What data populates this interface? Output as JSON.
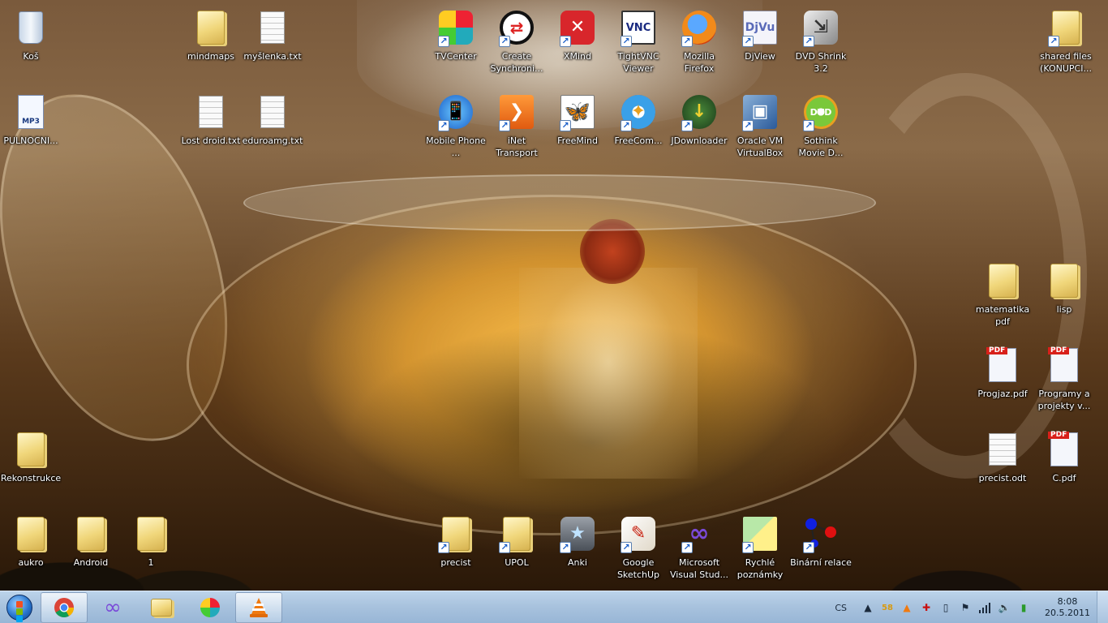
{
  "desktop_icons": {
    "recycle_bin": {
      "label": "Koš",
      "icon": "recycle-bin-icon"
    },
    "mindmaps": {
      "label": "mindmaps",
      "icon": "folder-icon"
    },
    "myslenka": {
      "label": "myšlenka.txt",
      "icon": "text-file-icon"
    },
    "tvcenter": {
      "label": "TVCenter",
      "icon": "tvcenter-icon"
    },
    "create_sync": {
      "label": "Create Synchroni...",
      "icon": "sync-icon"
    },
    "xmind": {
      "label": "XMind",
      "icon": "xmind-icon"
    },
    "tightvnc": {
      "label": "TightVNC Viewer",
      "icon": "vnc-icon"
    },
    "firefox": {
      "label": "Mozilla Firefox",
      "icon": "firefox-icon"
    },
    "djview": {
      "label": "DjView",
      "icon": "djview-icon"
    },
    "dvdshrink": {
      "label": "DVD Shrink 3.2",
      "icon": "dvd-shrink-icon"
    },
    "shared_files": {
      "label": "shared files (KONUPCI...",
      "icon": "folder-icon"
    },
    "pulnocni": {
      "label": "PULNOCNI...",
      "icon": "mp3-file-icon",
      "badge": "MP3"
    },
    "lost_droid": {
      "label": "Lost droid.txt",
      "icon": "text-file-icon"
    },
    "eduroamg": {
      "label": "eduroamg.txt",
      "icon": "text-file-icon"
    },
    "mobile_phone": {
      "label": "Mobile Phone ...",
      "icon": "mobile-phone-icon"
    },
    "inet_transport": {
      "label": "iNet Transport",
      "icon": "transport-icon"
    },
    "freemind": {
      "label": "FreeMind",
      "icon": "butterfly-icon"
    },
    "freecom": {
      "label": "FreeCom...",
      "icon": "compass-icon"
    },
    "jdownloader": {
      "label": "JDownloader",
      "icon": "jdownloader-icon"
    },
    "virtualbox": {
      "label": "Oracle VM VirtualBox",
      "icon": "virtualbox-icon"
    },
    "sothink": {
      "label": "Sothink Movie D...",
      "icon": "dvd-icon"
    },
    "matematika": {
      "label": "matematika pdf",
      "icon": "folder-icon"
    },
    "lisp": {
      "label": "lisp",
      "icon": "folder-icon"
    },
    "progjaz": {
      "label": "Progjaz.pdf",
      "icon": "pdf-file-icon"
    },
    "programy": {
      "label": "Programy a projekty v...",
      "icon": "pdf-file-icon"
    },
    "rekonstrukce": {
      "label": "Rekonstrukce",
      "icon": "folder-icon"
    },
    "precist_odt": {
      "label": "precist.odt",
      "icon": "document-icon"
    },
    "c_pdf": {
      "label": "C.pdf",
      "icon": "pdf-file-icon"
    },
    "aukro": {
      "label": "aukro",
      "icon": "folder-icon"
    },
    "android": {
      "label": "Android",
      "icon": "folder-icon"
    },
    "one": {
      "label": "1",
      "icon": "folder-icon"
    },
    "precist": {
      "label": "precist",
      "icon": "folder-icon"
    },
    "upol": {
      "label": "UPOL",
      "icon": "folder-icon"
    },
    "anki": {
      "label": "Anki",
      "icon": "anki-icon"
    },
    "sketchup": {
      "label": "Google SketchUp",
      "icon": "sketchup-icon"
    },
    "visual_studio": {
      "label": "Microsoft Visual Stud...",
      "icon": "visual-studio-icon"
    },
    "rychle_poznamky": {
      "label": "Rychlé poznámky",
      "icon": "sticky-notes-icon"
    },
    "binarni_relace": {
      "label": "Binární relace",
      "icon": "graph-icon"
    }
  },
  "taskbar": {
    "start_icon": "windows-start-icon",
    "pinned": [
      {
        "name": "chrome",
        "icon": "chrome-icon",
        "active": true
      },
      {
        "name": "visual-studio",
        "icon": "visual-studio-icon",
        "active": false
      },
      {
        "name": "explorer",
        "icon": "folder-icon",
        "active": false
      },
      {
        "name": "tvcenter",
        "icon": "tvcenter-icon",
        "active": false
      },
      {
        "name": "vlc",
        "icon": "vlc-icon",
        "active": true
      }
    ],
    "tray": {
      "language": "CS",
      "badge_number": "58",
      "clock_time": "8:08",
      "clock_date": "20.5.2011"
    }
  },
  "colors": {
    "taskbar": "#a9c3de",
    "label_text": "#ffffff",
    "folder": "#f0d67a",
    "pdf_red": "#d8201a"
  }
}
